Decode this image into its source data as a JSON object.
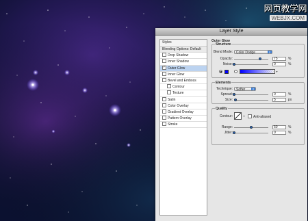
{
  "watermark": {
    "chinese": "网页教学网",
    "url": "WEBJX.COM"
  },
  "dialog": {
    "title": "Layer Style",
    "styles_list": {
      "header": "Styles",
      "blending_options": "Blending Options: Default",
      "items": [
        {
          "label": "Drop Shadow",
          "checked": false
        },
        {
          "label": "Inner Shadow",
          "checked": false
        },
        {
          "label": "Outer Glow",
          "checked": true
        },
        {
          "label": "Inner Glow",
          "checked": false
        },
        {
          "label": "Bevel and Emboss",
          "checked": false
        },
        {
          "label": "Contour",
          "checked": false
        },
        {
          "label": "Texture",
          "checked": false
        },
        {
          "label": "Satin",
          "checked": false
        },
        {
          "label": "Color Overlay",
          "checked": false
        },
        {
          "label": "Gradient Overlay",
          "checked": false
        },
        {
          "label": "Pattern Overlay",
          "checked": false
        },
        {
          "label": "Stroke",
          "checked": false
        }
      ]
    },
    "outer_glow": {
      "section_title": "Outer Glow",
      "structure": {
        "title": "Structure",
        "blend_mode_label": "Blend Mode:",
        "blend_mode_value": "Color Dodge",
        "opacity_label": "Opacity:",
        "opacity_value": "75",
        "opacity_unit": "%",
        "noise_label": "Noise:",
        "noise_value": "0",
        "noise_unit": "%",
        "glow_color": "#0000ff"
      },
      "elements": {
        "title": "Elements",
        "technique_label": "Technique:",
        "technique_value": "Softer",
        "spread_label": "Spread:",
        "spread_value": "0",
        "spread_unit": "%",
        "size_label": "Size:",
        "size_value": "5",
        "size_unit": "px"
      },
      "quality": {
        "title": "Quality",
        "contour_label": "Contour:",
        "anti_aliased_label": "Anti-aliased",
        "range_label": "Range:",
        "range_value": "50",
        "range_unit": "%",
        "jitter_label": "Jitter:",
        "jitter_value": "0",
        "jitter_unit": "%"
      }
    }
  },
  "colors": {
    "accent": "#3f7fd6",
    "selection": "#bcd3f0"
  }
}
